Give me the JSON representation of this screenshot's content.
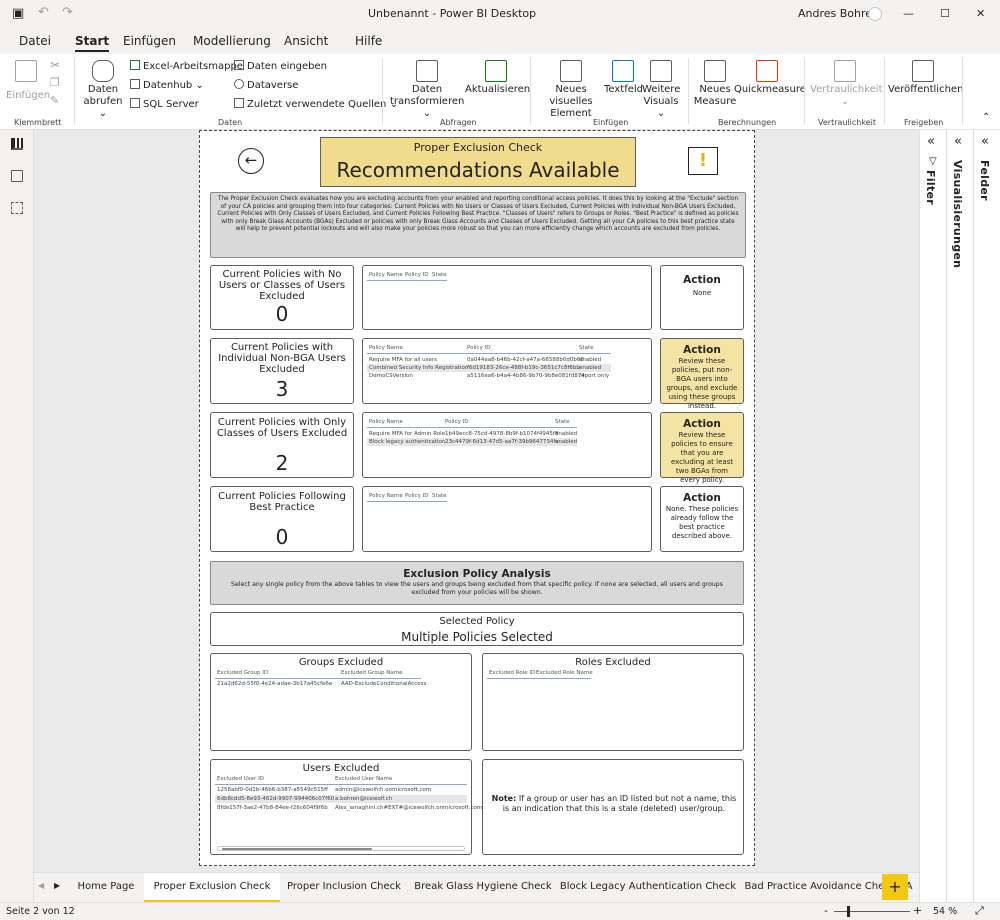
{
  "titlebar": {
    "title": "Unbenannt - Power BI Desktop",
    "user": "Andres Bohren",
    "minimize": "—",
    "maximize": "☐",
    "close": "✕"
  },
  "menu_tabs": [
    "Datei",
    "Start",
    "Einfügen",
    "Modellierung",
    "Ansicht",
    "Hilfe"
  ],
  "ribbon": {
    "einfuegen": "Einfügen",
    "daten_abrufen_1": "Daten",
    "daten_abrufen_2": "abrufen ⌄",
    "excel": "Excel-Arbeitsmappe",
    "datenhub": "Datenhub ⌄",
    "sql": "SQL Server",
    "daten_eingeben": "Daten eingeben",
    "dataverse": "Dataverse",
    "zuletzt": "Zuletzt verwendete Quellen ⌄",
    "transform_1": "Daten",
    "transform_2": "transformieren ⌄",
    "aktualisieren": "Aktualisieren",
    "neues_visuelles_1": "Neues visuelles",
    "neues_visuelles_2": "Element",
    "textfeld": "Textfeld",
    "weitere_1": "Weitere",
    "weitere_2": "Visuals ⌄",
    "neues_measure_1": "Neues",
    "neues_measure_2": "Measure",
    "quickmeasure": "Quickmeasure",
    "vertraulichkeit": "Vertraulichkeit",
    "veroeffentlichen": "Veröffentlichen",
    "groups": {
      "klemmbrett": "Klemmbrett",
      "daten": "Daten",
      "abfragen": "Abfragen",
      "einfuegen": "Einfügen",
      "berechnungen": "Berechnungen",
      "vertraulichkeit": "Vertraulichkeit",
      "freigeben": "Freigeben"
    }
  },
  "panes": {
    "filter": "Filter",
    "visualisierungen": "Visualisierungen",
    "felder": "Felder"
  },
  "report": {
    "header_small": "Proper Exclusion Check",
    "header_big": "Recommendations Available",
    "warning_symbol": "!",
    "description": "The Proper Exclusion Check evaluates how you are excluding accounts from your enabled and reporting conditional access policies. It does this by looking at the \"Exclude\" section of your CA policies and grouping them into four categories: Current Policies with No Users or Classes of Users Excluded, Current Policies with Individual Non-BGA Users Excluded, Current Policies with Only Classes of Users Excluded, and Current Policies Following Best Practice. \"Classes of Users\" refers to Groups or Roles. \"Best Practice\" is defined as policies with only Break Glass Accounts (BGAs) Excluded or policies with only Break Glass Accounts and Classes of Users Excluded. Getting all your CA policies to this best practice state will help to prevent potential lockouts and will also make your policies more robust so that you can more efficiently change which accounts are excluded from policies.",
    "rows": [
      {
        "card_title": "Current Policies with No Users or Classes of Users Excluded",
        "count": "0",
        "table_headers": [
          "Policy Name",
          "Policy ID",
          "State"
        ],
        "table_rows": [],
        "action_title": "Action",
        "action_text": "None"
      },
      {
        "card_title": "Current Policies with Individual Non-BGA Users Excluded",
        "count": "3",
        "table_headers": [
          "Policy Name",
          "Policy ID",
          "State"
        ],
        "table_rows": [
          [
            "Require MFA for all users",
            "0a044aa8-b46b-42cf-a47a-66588b0d0b66",
            "enabled"
          ],
          [
            "Combined Security Info Registration",
            "f6d19183-26ce-488f-b19c-3651c7c8f6bb",
            "enabled"
          ],
          [
            "DemoCSVersion",
            "a5116ea6-b4a4-4b86-9b70-9b8e081fd874",
            "report only"
          ]
        ],
        "action_title": "Action",
        "action_text": "Review these policies, put non-BGA users into groups, and exclude using these groups instead."
      },
      {
        "card_title": "Current Policies with Only Classes of Users Excluded",
        "count": "2",
        "table_headers": [
          "Policy Name",
          "Policy ID",
          "State"
        ],
        "table_rows": [
          [
            "Require MFA for Admin Role",
            "1b49ecc8-75cd-4978-8b9f-b1074f4945f8",
            "enabled"
          ],
          [
            "Block legacy authentication",
            "23c4479f-6d13-47d5-aa7f-39b9647734fa",
            "enabled"
          ]
        ],
        "action_title": "Action",
        "action_text": "Review these policies to ensure that you are excluding at least two BGAs from every policy."
      },
      {
        "card_title": "Current Policies Following Best Practice",
        "count": "0",
        "table_headers": [
          "Policy Name",
          "Policy ID",
          "State"
        ],
        "table_rows": [],
        "action_title": "Action",
        "action_text": "None. These policies already follow the best practice described above."
      }
    ],
    "analysis_title": "Exclusion Policy Analysis",
    "analysis_text": "Select any single policy from the above tables to view the users and groups being excluded from that specific policy. If none are selected, all users and groups excluded from your policies will be shown.",
    "selected_label": "Selected Policy",
    "selected_value": "Multiple Policies Selected",
    "groups_excluded": {
      "title": "Groups Excluded",
      "headers": [
        "Excluded Group ID",
        "Excluded Group Name"
      ],
      "rows": [
        [
          "21a2d62d-55f0-4e24-adae-3b17a45cfe6e",
          "AAD-ExcludeConditionalAccess"
        ]
      ]
    },
    "roles_excluded": {
      "title": "Roles Excluded",
      "headers": [
        "Excluded Role ID",
        "Excluded Role Name"
      ]
    },
    "users_excluded": {
      "title": "Users Excluded",
      "headers": [
        "Excluded User ID",
        "Excluded User Name"
      ],
      "rows": [
        [
          "1258abf0-0d1b-46b6-b387-a5549c515ff",
          "admin@icewolfch.onmicrosoft.com"
        ],
        [
          "6db8cdd5-8e93-462d-9907-994406c07f60",
          "a.bohren@icewolf.ch"
        ],
        [
          "8fde157f-3ae2-47b8-84ee-f26c604f9f6b",
          "Alex_amaghini.ch#EXT#@icewolfch.onmicrosoft.com"
        ]
      ]
    },
    "note_bold": "Note:",
    "note_text": " If a group or user has an ID listed but not a name, this is an indication that this is a stale (deleted) user/group."
  },
  "page_tabs": [
    "Home Page",
    "Proper Exclusion Check",
    "Proper Inclusion Check",
    "Break Glass Hygiene Check",
    "Block Legacy Authentication Check",
    "Bad Practice Avoidance Check",
    "A"
  ],
  "page_tabs_active": 1,
  "status": {
    "page": "Seite 2 von 12",
    "zoom": "54 %"
  },
  "colors": {
    "accent_yellow": "#f2c811",
    "action_yellow": "#f4e3a3",
    "header_yellow": "#f0dc8c"
  }
}
